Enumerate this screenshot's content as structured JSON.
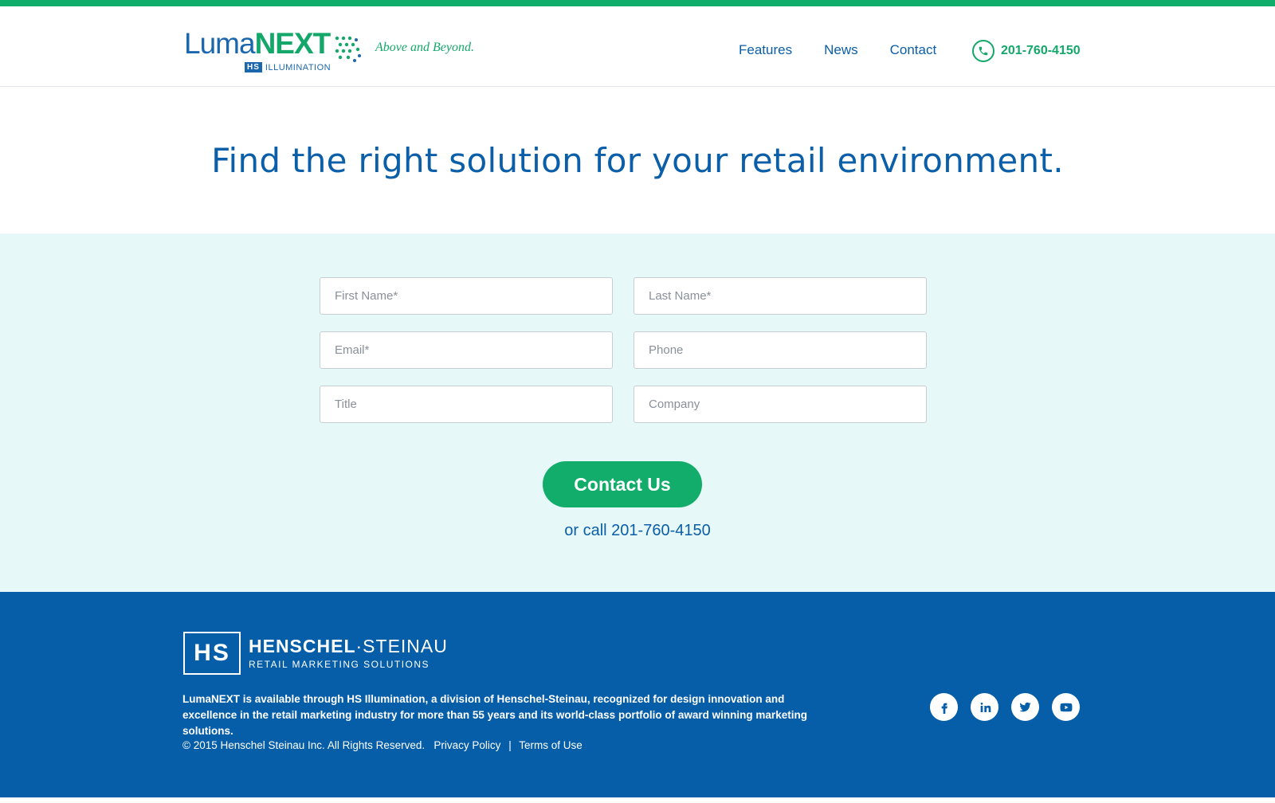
{
  "header": {
    "logo_text_luma": "Luma",
    "logo_text_next": "NEXT",
    "logo_hs": "HS",
    "logo_illumination": "ILLUMINATION",
    "tagline": "Above and Beyond.",
    "nav": [
      "Features",
      "News",
      "Contact"
    ],
    "phone": "201-760-4150",
    "phone_icon": "phone-icon"
  },
  "hero": {
    "title": "Find the right solution for your retail environment."
  },
  "form": {
    "first_name_placeholder": "First Name*",
    "last_name_placeholder": "Last Name*",
    "email_placeholder": "Email*",
    "phone_placeholder": "Phone",
    "title_placeholder": "Title",
    "company_placeholder": "Company",
    "submit_label": "Contact Us",
    "or_call": "or call 201-760-4150"
  },
  "footer": {
    "logo_mark": "HS",
    "logo_name_bold": "HENSCHEL",
    "logo_name_rest": "·STEINAU",
    "logo_sub": "RETAIL MARKETING SOLUTIONS",
    "description": "LumaNEXT is available through HS Illumination, a division of Henschel-Steinau, recognized for design innovation and excellence in the retail marketing industry for more than 55 years and its world-class portfolio of award winning marketing solutions.",
    "copyright": "© 2015 Henschel Steinau Inc. All Rights Reserved.",
    "privacy": "Privacy Policy",
    "separator": "|",
    "terms": "Terms of Use",
    "social": [
      "facebook-icon",
      "linkedin-icon",
      "twitter-icon",
      "youtube-icon"
    ]
  },
  "colors": {
    "brand_green": "#13ad6b",
    "brand_blue": "#055ea7",
    "form_bg": "#e6f8f8"
  }
}
